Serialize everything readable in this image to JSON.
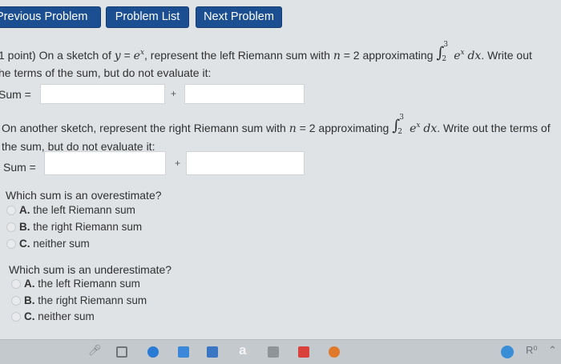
{
  "nav": {
    "prev_label": "Previous Problem",
    "list_label": "Problem List",
    "next_label": "Next Problem"
  },
  "problem": {
    "points": "1 point)",
    "q1_text_a": "On a sketch of",
    "q1_y": "y",
    "q1_eq": "=",
    "q1_e": "e",
    "q1_x": "x",
    "q1_text_b": ", represent the left Riemann sum with",
    "n": "n",
    "n_eq": "= 2",
    "q1_text_c": "approximating",
    "int_lower": "2",
    "int_upper": "3",
    "integrand_e": "e",
    "integrand_x": "x",
    "dx": "dx",
    "q1_text_d": ". Write out",
    "q1_line2": "he terms of the sum, but do not evaluate it:",
    "sum_label": "Sum =",
    "plus": "+",
    "q2_text_a": "On another sketch, represent the right Riemann sum with",
    "q2_text_b": "approximating",
    "q2_text_c": ". Write out the terms of",
    "q2_line2": "the sum, but do not evaluate it:"
  },
  "mc1": {
    "question": "Which sum is an overestimate?",
    "options": [
      {
        "letter": "A.",
        "text": "the left Riemann sum"
      },
      {
        "letter": "B.",
        "text": "the right Riemann sum"
      },
      {
        "letter": "C.",
        "text": "neither sum"
      }
    ]
  },
  "mc2": {
    "question": "Which sum is an underestimate?",
    "options": [
      {
        "letter": "A.",
        "text": "the left Riemann sum"
      },
      {
        "letter": "B.",
        "text": "the right Riemann sum"
      },
      {
        "letter": "C.",
        "text": "neither sum"
      }
    ]
  },
  "taskbar": {
    "icons": [
      "mic-icon",
      "task-view-icon",
      "edge-icon",
      "mail-icon",
      "store-icon",
      "amazon-icon",
      "media-icon",
      "acrobat-icon",
      "media-player-icon",
      "help-icon",
      "people-icon",
      "chevron-up-icon"
    ],
    "amazon_glyph": "a",
    "people_glyph": "R⁰"
  },
  "colors": {
    "nav_button": "#1c4f91",
    "page_background": "#dfe3e6",
    "field_background": "#ffffff",
    "taskbar": "#c4c9ce"
  }
}
